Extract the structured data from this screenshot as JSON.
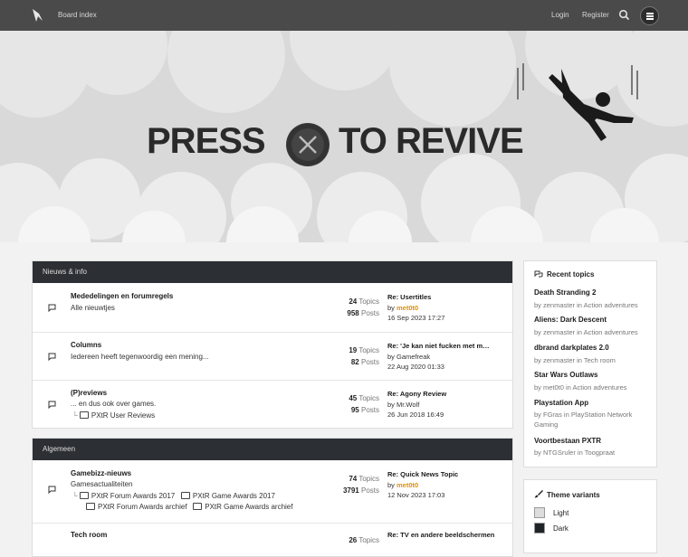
{
  "nav": {
    "board_index": "Board index",
    "login": "Login",
    "register": "Register"
  },
  "banner": {
    "title_left": "PRESS",
    "title_right": "TO REVIVE"
  },
  "sections": [
    {
      "header": "Nieuws & info",
      "forums": [
        {
          "title": "Mededelingen en forumregels",
          "description": "Alle nieuwtjes",
          "topics": "24",
          "topics_label": "Topics",
          "posts": "958",
          "posts_label": "Posts",
          "last_title": "Re: Usertitles",
          "last_by_prefix": "by",
          "last_user": "met0t0",
          "last_date": "16 Sep 2023 17:27"
        },
        {
          "title": "Columns",
          "description": "Iedereen heeft tegenwoordig een mening...",
          "topics": "19",
          "topics_label": "Topics",
          "posts": "82",
          "posts_label": "Posts",
          "last_title": "Re: 'Je kan niet fucken met m…",
          "last_by_prefix": "by",
          "last_user": "Gamefreak",
          "last_date": "22 Aug 2020 01:33"
        },
        {
          "title": "(P)reviews",
          "description": "... en dus ook over games.",
          "subforum": "PXtR User Reviews",
          "topics": "45",
          "topics_label": "Topics",
          "posts": "95",
          "posts_label": "Posts",
          "last_title": "Re: Agony Review",
          "last_by_prefix": "by",
          "last_user": "Mr.Wolf",
          "last_date": "26 Jun 2018 16:49"
        }
      ]
    },
    {
      "header": "Algemeen",
      "forums": [
        {
          "title": "Gamebizz-nieuws",
          "description": "Gamesactualiteiten",
          "subforums_line1": [
            "PXtR Forum Awards 2017",
            "PXtR Game Awards 2017"
          ],
          "subforums_line2": [
            "PXtR Forum Awards archief",
            "PXtR Game Awards archief"
          ],
          "topics": "74",
          "topics_label": "Topics",
          "posts": "3791",
          "posts_label": "Posts",
          "last_title": "Re: Quick News Topic",
          "last_by_prefix": "by",
          "last_user": "met0t0",
          "last_date": "12 Nov 2023 17:03"
        },
        {
          "title": "Tech room",
          "topics": "26",
          "topics_label": "Topics",
          "last_title": "Re: TV en andere beeldschermen"
        }
      ]
    }
  ],
  "recent_topics": {
    "header": "Recent topics",
    "items": [
      {
        "title": "Death Stranding 2",
        "meta": "by zenmaster in Action adventures"
      },
      {
        "title": "Aliens: Dark Descent",
        "meta": "by zenmaster in Action adventures"
      },
      {
        "title": "dbrand darkplates 2.0",
        "meta": "by zenmaster in Tech room"
      },
      {
        "title": "Star Wars Outlaws",
        "meta": "by met0t0 in Action adventures"
      },
      {
        "title": "Playstation App",
        "meta": "by FGras in PlayStation Network Gaming"
      },
      {
        "title": "Voortbestaan PXTR",
        "meta": "by NTGSruler in Toogpraat"
      }
    ]
  },
  "theme_variants": {
    "header": "Theme variants",
    "options": [
      {
        "label": "Light",
        "color": "#dddddd"
      },
      {
        "label": "Dark",
        "color": "#1f2326"
      }
    ]
  },
  "colors": {
    "header_bg": "#2c2f33",
    "username_accent": "#e38f00"
  }
}
